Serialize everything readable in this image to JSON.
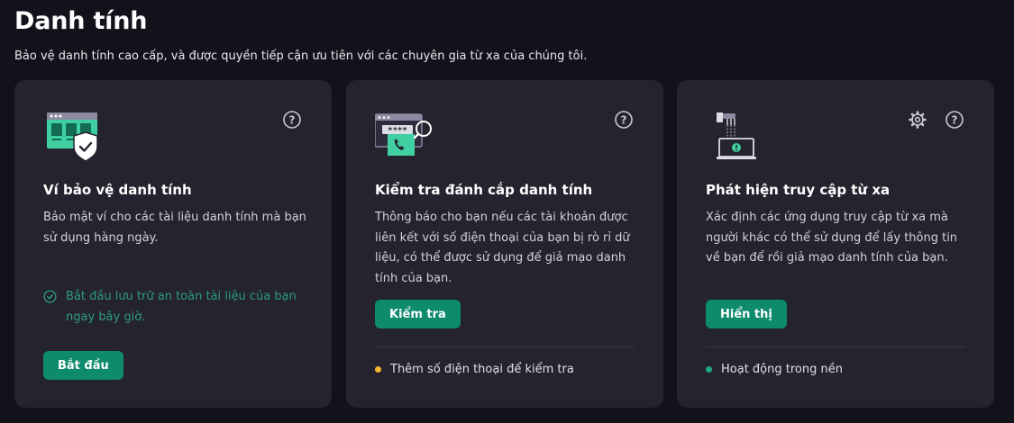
{
  "page": {
    "title": "Danh tính",
    "subtitle": "Bảo vệ danh tính cao cấp, và được quyền tiếp cận ưu tiên với các chuyên gia từ xa của chúng tôi."
  },
  "cards": [
    {
      "title": "Ví bảo vệ danh tính",
      "description": "Bảo mật ví cho các tài liệu danh tính mà bạn sử dụng hàng ngày.",
      "status_text": "Bắt đầu lưu trữ an toàn tài liệu của bạn ngay bây giờ.",
      "button_label": "Bắt đầu",
      "icon": "identity-wallet-illustration"
    },
    {
      "title": "Kiểm tra đánh cắp danh tính",
      "description": "Thông báo cho bạn nếu các tài khoản được liên kết với số điện thoại của bạn bị rò rỉ dữ liệu, có thể được sử dụng để giả mạo danh tính của bạn.",
      "button_label": "Kiểm tra",
      "footer_status": "Thêm số điện thoại để kiểm tra",
      "status_color": "#f5b731",
      "icon": "identity-theft-check-illustration"
    },
    {
      "title": "Phát hiện truy cập từ xa",
      "description": "Xác định các ứng dụng truy cập từ xa mà người khác có thể sử dụng để lấy thông tin về bạn để rồi giả mạo danh tính của bạn.",
      "button_label": "Hiển thị",
      "footer_status": "Hoạt động trong nền",
      "status_color": "#1fa882",
      "icon": "remote-access-illustration"
    }
  ],
  "colors": {
    "accent": "#0e8a6c",
    "success_text": "#2e9c7d",
    "card_bg": "#24232e",
    "page_bg": "#12121b"
  }
}
